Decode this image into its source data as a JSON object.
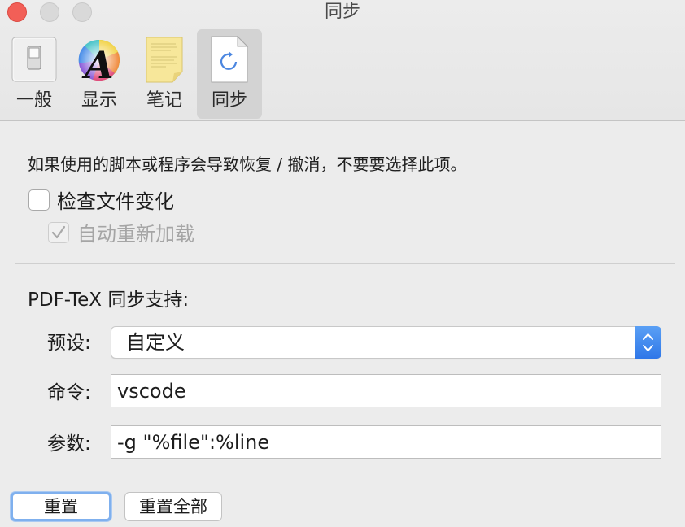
{
  "window": {
    "title": "同步"
  },
  "toolbar": {
    "items": [
      {
        "label": "一般",
        "icon": "switch-icon"
      },
      {
        "label": "显示",
        "icon": "font-color-wheel-icon"
      },
      {
        "label": "笔记",
        "icon": "note-paper-icon"
      },
      {
        "label": "同步",
        "icon": "sync-document-icon",
        "selected": true
      }
    ]
  },
  "sync": {
    "note": "如果使用的脚本或程序会导致恢复 / 撤消，不要要选择此项。",
    "check_changes": {
      "label": "检查文件变化",
      "checked": false
    },
    "auto_reload": {
      "label": "自动重新加载",
      "checked": true,
      "enabled": false
    }
  },
  "pdftex": {
    "section_title": "PDF-TeX 同步支持:",
    "preset": {
      "label": "预设:",
      "value": "自定义"
    },
    "command": {
      "label": "命令:",
      "value": "vscode"
    },
    "arguments": {
      "label": "参数:",
      "value": "-g \"%file\":%line"
    }
  },
  "buttons": {
    "reset": "重置",
    "reset_all": "重置全部"
  },
  "colors": {
    "accent": "#2f77e8",
    "close": "#f25f57",
    "selected_tab": "#d3d3d3"
  }
}
